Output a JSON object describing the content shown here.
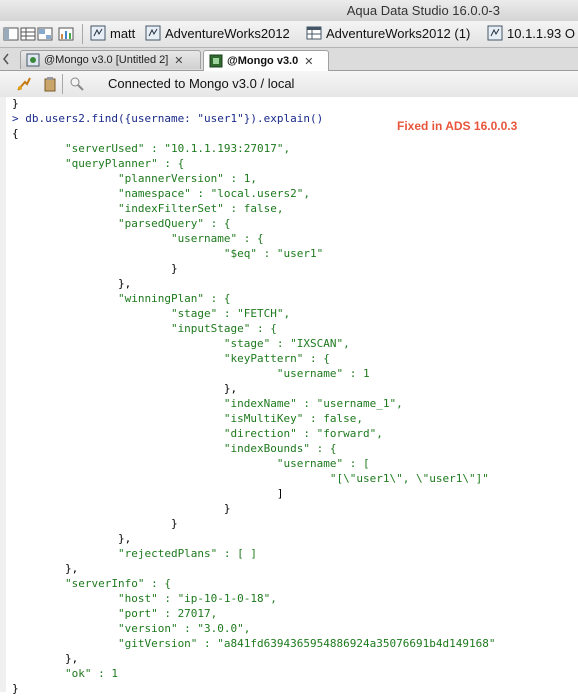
{
  "window": {
    "title": "Aqua Data Studio 16.0.0-3"
  },
  "connections_bar": {
    "items": [
      {
        "label": "matt"
      },
      {
        "label": "AdventureWorks2012"
      },
      {
        "label": "AdventureWorks2012 (1)"
      },
      {
        "label": "10.1.1.93 O"
      }
    ]
  },
  "tabs": [
    {
      "label": "@Mongo v3.0 [Untitled 2]",
      "close": "✕",
      "active": false
    },
    {
      "label": "@Mongo v3.0",
      "close": "✕",
      "active": true
    }
  ],
  "query_toolbar": {
    "status": "Connected to Mongo v3.0 / local"
  },
  "annotation": "Fixed in ADS 16.0.0.3",
  "editor": {
    "lines": [
      "}",
      "> db.users2.find({username: \"user1\"}).explain()",
      "{",
      "        \"serverUsed\" : \"10.1.1.193:27017\",",
      "        \"queryPlanner\" : {",
      "                \"plannerVersion\" : 1,",
      "                \"namespace\" : \"local.users2\",",
      "                \"indexFilterSet\" : false,",
      "                \"parsedQuery\" : {",
      "                        \"username\" : {",
      "                                \"$eq\" : \"user1\"",
      "                        }",
      "                },",
      "                \"winningPlan\" : {",
      "                        \"stage\" : \"FETCH\",",
      "                        \"inputStage\" : {",
      "                                \"stage\" : \"IXSCAN\",",
      "                                \"keyPattern\" : {",
      "                                        \"username\" : 1",
      "                                },",
      "                                \"indexName\" : \"username_1\",",
      "                                \"isMultiKey\" : false,",
      "                                \"direction\" : \"forward\",",
      "                                \"indexBounds\" : {",
      "                                        \"username\" : [",
      "                                                \"[\\\"user1\\\", \\\"user1\\\"]\"",
      "                                        ]",
      "                                }",
      "                        }",
      "                },",
      "                \"rejectedPlans\" : [ ]",
      "        },",
      "        \"serverInfo\" : {",
      "                \"host\" : \"ip-10-1-0-18\",",
      "                \"port\" : 27017,",
      "                \"version\" : \"3.0.0\",",
      "                \"gitVersion\" : \"a841fd6394365954886924a35076691b4d149168\"",
      "        },",
      "        \"ok\" : 1",
      "}"
    ]
  },
  "colors": {
    "output_text": "#1e7a1e",
    "prompt_text": "#1a2a8a",
    "annotation": "#e8553b"
  }
}
